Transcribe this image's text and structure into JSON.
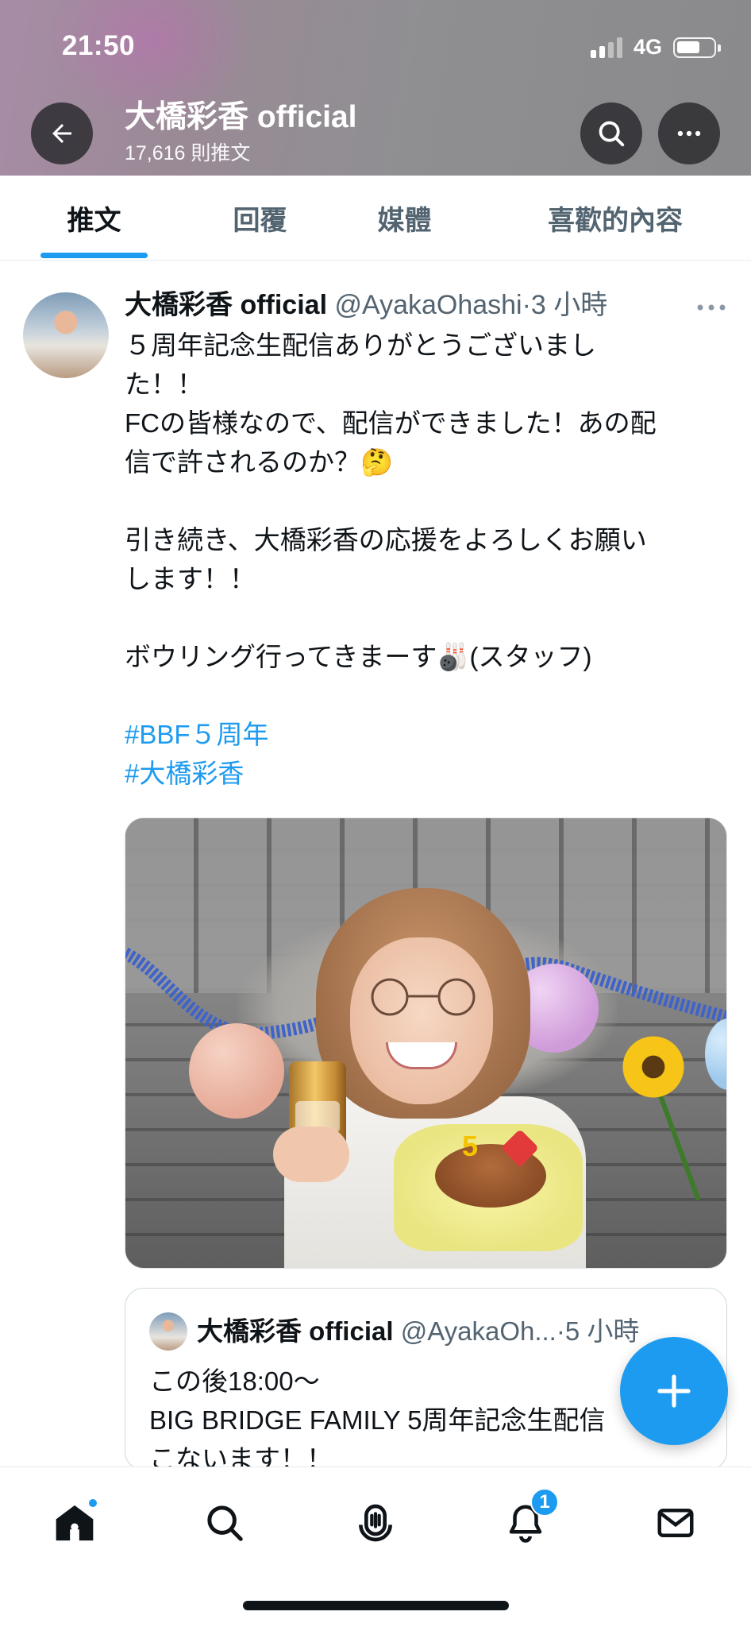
{
  "status_bar": {
    "time": "21:50",
    "network": "4G"
  },
  "header": {
    "name": "大橋彩香 official",
    "tweet_count": "17,616 則推文",
    "icons": [
      "back-arrow-icon",
      "search-icon",
      "more-icon"
    ]
  },
  "tabs": [
    {
      "label": "推文",
      "active": true
    },
    {
      "label": "回覆",
      "active": false
    },
    {
      "label": "媒體",
      "active": false
    },
    {
      "label": "喜歡的內容",
      "active": false
    }
  ],
  "tweet": {
    "display_name": "大橋彩香 official",
    "handle": "@AyakaOhashi",
    "time": "·3 小時",
    "lines": [
      "５周年記念生配信ありがとうございまし",
      "た！！",
      "FCの皆様なので、配信ができました！あの配",
      "信で許されるのか？🤔",
      "",
      "引き続き、大橋彩香の応援をよろしくお願い",
      "します！！",
      "",
      "ボウリング行ってきまーす🎳(スタッフ)",
      ""
    ],
    "hashtags": [
      "#BBF５周年",
      "#大橋彩香"
    ]
  },
  "quoted_tweet": {
    "display_name": "大橋彩香 official",
    "handle": "@AyakaOh...",
    "time": "·5 小時",
    "lines": [
      "この後18:00～",
      "BIG BRIDGE FAMILY 5周年記念生配信",
      "こないます！！"
    ]
  },
  "bottom_nav": {
    "items": [
      "home-icon",
      "search-icon",
      "spaces-icon",
      "notifications-icon",
      "messages-icon"
    ],
    "notification_badge": "1"
  },
  "colors": {
    "accent": "#1d9bf0",
    "text": "#0f1419",
    "secondary_text": "#536471"
  }
}
